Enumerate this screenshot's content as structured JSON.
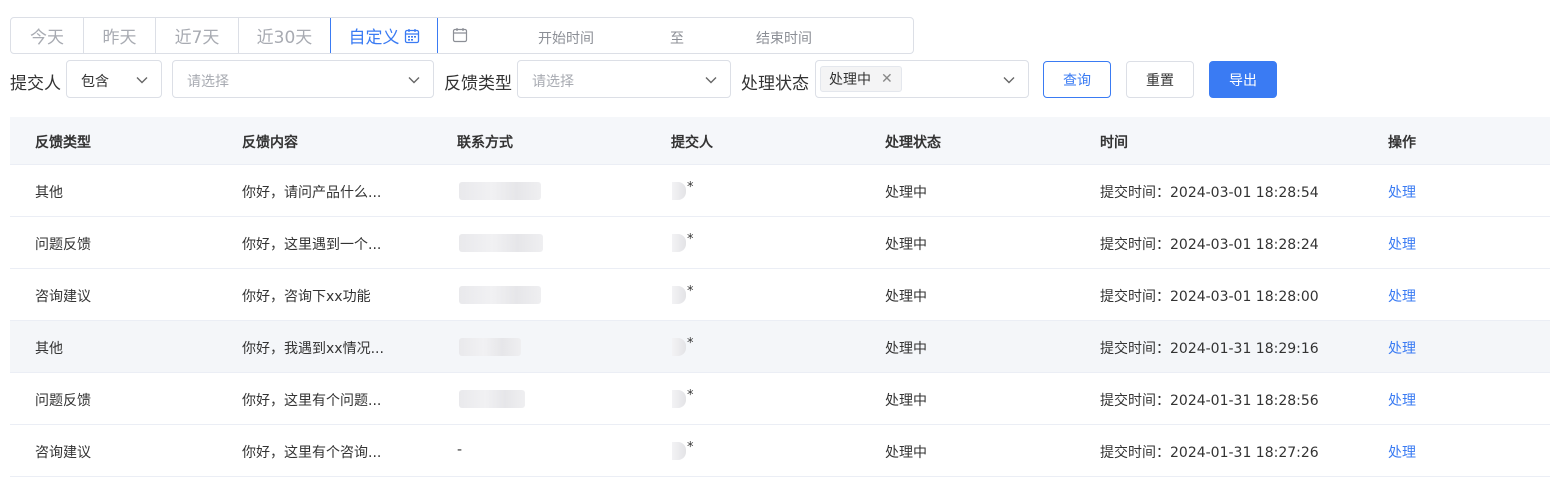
{
  "date_tabs": {
    "today": "今天",
    "yesterday": "昨天",
    "last7": "近7天",
    "last30": "近30天",
    "custom": "自定义"
  },
  "range": {
    "start_placeholder": "开始时间",
    "separator": "至",
    "end_placeholder": "结束时间"
  },
  "filters": {
    "submitter_label": "提交人",
    "match_mode_value": "包含",
    "submitter_placeholder": "请选择",
    "type_label": "反馈类型",
    "type_placeholder": "请选择",
    "status_label": "处理状态",
    "status_tag": "处理中"
  },
  "buttons": {
    "query": "查询",
    "reset": "重置",
    "export": "导出"
  },
  "table": {
    "headers": {
      "type": "反馈类型",
      "content": "反馈内容",
      "contact": "联系方式",
      "submitter": "提交人",
      "status": "处理状态",
      "time": "时间",
      "action": "操作"
    },
    "rows": [
      {
        "type": "其他",
        "content": "你好，请问产品什么...",
        "contact": "",
        "submitter": "*",
        "status": "处理中",
        "time": "提交时间：2024-03-01 18:28:54",
        "action": "处理"
      },
      {
        "type": "问题反馈",
        "content": "你好，这里遇到一个...",
        "contact": "",
        "submitter": "*",
        "status": "处理中",
        "time": "提交时间：2024-03-01 18:28:24",
        "action": "处理"
      },
      {
        "type": "咨询建议",
        "content": "你好，咨询下xx功能",
        "contact": "",
        "submitter": "*",
        "status": "处理中",
        "time": "提交时间：2024-03-01 18:28:00",
        "action": "处理"
      },
      {
        "type": "其他",
        "content": "你好，我遇到xx情况...",
        "contact": "",
        "submitter": "*",
        "status": "处理中",
        "time": "提交时间：2024-01-31 18:29:16",
        "action": "处理"
      },
      {
        "type": "问题反馈",
        "content": "你好，这里有个问题...",
        "contact": "",
        "submitter": "*",
        "status": "处理中",
        "time": "提交时间：2024-01-31 18:28:56",
        "action": "处理"
      },
      {
        "type": "咨询建议",
        "content": "你好，这里有个咨询...",
        "contact": "-",
        "submitter": "*",
        "status": "处理中",
        "time": "提交时间：2024-01-31 18:27:26",
        "action": "处理"
      }
    ]
  },
  "colors": {
    "primary": "#3a7bf3",
    "border": "#dcdfe6",
    "header_bg": "#f5f7fa",
    "hover_row_bg": "#f4f6f9"
  }
}
